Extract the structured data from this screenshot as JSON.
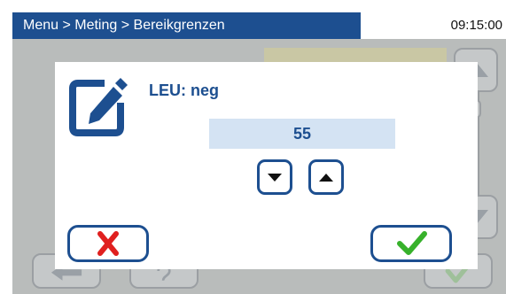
{
  "header": {
    "breadcrumb": "Menu > Meting > Bereikgrenzen",
    "time": "09:15:00"
  },
  "dialog": {
    "parameter_label": "LEU: neg",
    "value": "55",
    "icons": {
      "edit": "edit-icon",
      "decrement": "triangle-down-icon",
      "increment": "triangle-up-icon",
      "cancel": "red-x-icon",
      "confirm": "green-check-icon"
    }
  },
  "background": {
    "icons": [
      "scroll-up-icon",
      "scroll-down-icon",
      "back-arrow-icon",
      "help-icon",
      "check-icon"
    ]
  },
  "colors": {
    "title_bar": "#1d4f90",
    "accent_blue": "#1d4f90",
    "value_field": "#d4e3f3",
    "cancel_red": "#e0201f",
    "confirm_green": "#37b12b",
    "overlay_gray": "#b9bcbb"
  }
}
